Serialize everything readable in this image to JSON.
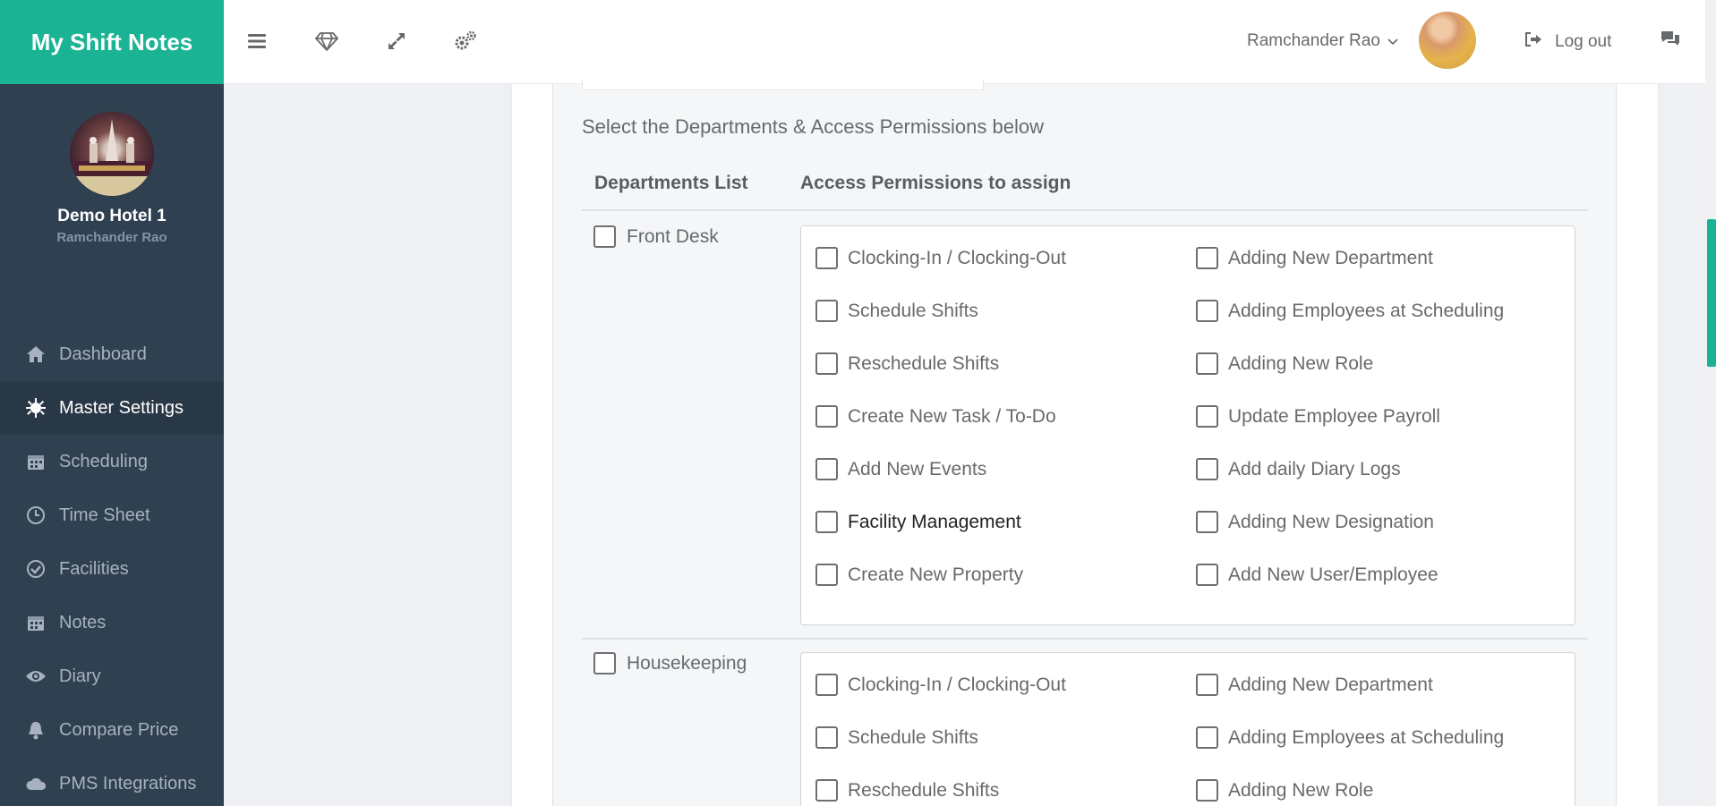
{
  "brand": "My Shift Notes",
  "sidebar": {
    "hotel": "Demo Hotel 1",
    "user": "Ramchander Rao",
    "items": [
      {
        "label": "Dashboard",
        "icon": "home-icon"
      },
      {
        "label": "Master Settings",
        "icon": "gear-icon",
        "active": true
      },
      {
        "label": "Scheduling",
        "icon": "calendar-icon"
      },
      {
        "label": "Time Sheet",
        "icon": "clock-icon"
      },
      {
        "label": "Facilities",
        "icon": "check-circle-icon"
      },
      {
        "label": "Notes",
        "icon": "calendar-icon"
      },
      {
        "label": "Diary",
        "icon": "eye-icon"
      },
      {
        "label": "Compare Price",
        "icon": "bell-icon"
      },
      {
        "label": "PMS Integrations",
        "icon": "cloud-icon"
      }
    ]
  },
  "topbar": {
    "user_name": "Ramchander Rao",
    "logout": "Log out"
  },
  "form": {
    "intro": "Select the Departments & Access Permissions below",
    "col_departments": "Departments List",
    "col_permissions": "Access Permissions to assign"
  },
  "departments": [
    {
      "name": "Front Desk",
      "left": [
        "Clocking-In / Clocking-Out",
        "Schedule Shifts",
        "Reschedule Shifts",
        "Create New Task / To-Do",
        "Add New Events",
        "Facility Management",
        "Create New Property"
      ],
      "right": [
        "Adding New Department",
        "Adding Employees at Scheduling",
        "Adding New Role",
        "Update Employee Payroll",
        "Add daily Diary Logs",
        "Adding New Designation",
        "Add New User/Employee"
      ]
    },
    {
      "name": "Housekeeping",
      "left": [
        "Clocking-In / Clocking-Out",
        "Schedule Shifts",
        "Reschedule Shifts"
      ],
      "right": [
        "Adding New Department",
        "Adding Employees at Scheduling",
        "Adding New Role"
      ]
    }
  ],
  "colors": {
    "brand": "#1ab394",
    "sidebar": "#2f4050",
    "sidebar_active": "#293846"
  }
}
